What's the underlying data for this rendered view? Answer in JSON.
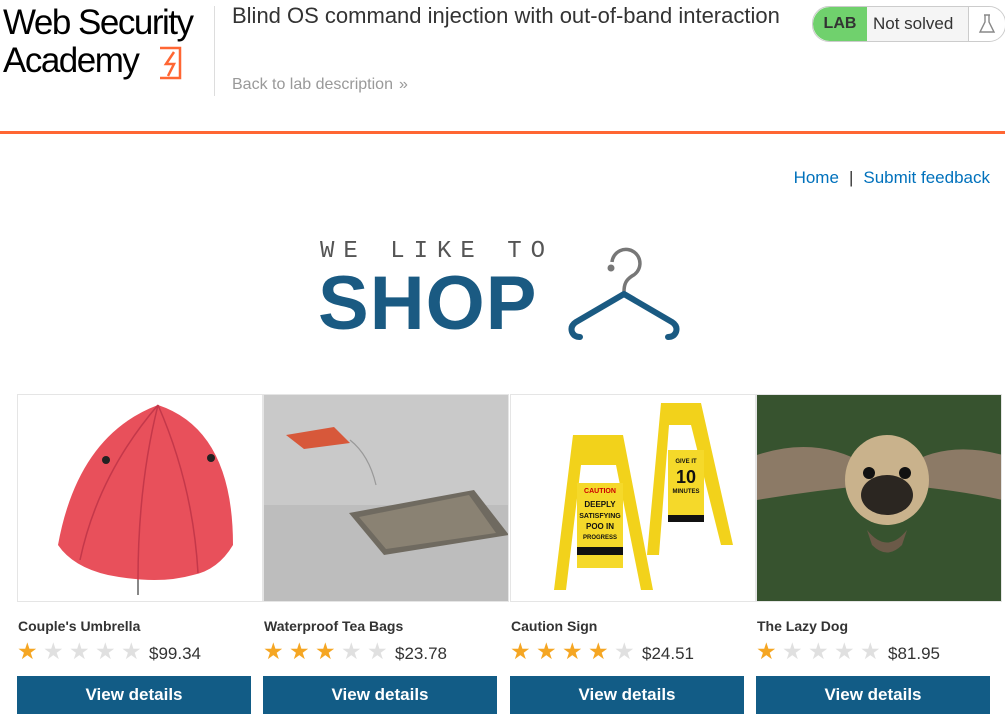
{
  "logo": {
    "line1": "Web Security",
    "line2": "Academy"
  },
  "lab": {
    "title": "Blind OS command injection with out-of-band interaction",
    "back_label": "Back to lab description",
    "status_badge": "LAB",
    "status_text": "Not solved"
  },
  "nav": {
    "home": "Home",
    "separator": "|",
    "feedback": "Submit feedback"
  },
  "banner": {
    "tagline": "WE LIKE TO",
    "headline": "SHOP"
  },
  "colors": {
    "accent": "#ff6633",
    "brand": "#125c86",
    "banner": "#1a5a82",
    "badge": "#70d16d",
    "star": "#f5a623",
    "link": "#0071bc"
  },
  "products": [
    {
      "name": "Couple's Umbrella",
      "rating": 1,
      "price": "$99.34",
      "button": "View details",
      "image": "umbrella"
    },
    {
      "name": "Waterproof Tea Bags",
      "rating": 3,
      "price": "$23.78",
      "button": "View details",
      "image": "tea-bag"
    },
    {
      "name": "Caution Sign",
      "rating": 4,
      "price": "$24.51",
      "button": "View details",
      "image": "caution-sign"
    },
    {
      "name": "The Lazy Dog",
      "rating": 1,
      "price": "$81.95",
      "button": "View details",
      "image": "flying-pug"
    }
  ],
  "images": {
    "caution_sign": {
      "left_text": [
        "CAUTION",
        "DEEPLY",
        "SATISFYING",
        "POO IN",
        "PROGRESS"
      ],
      "right_text": [
        "GIVE IT",
        "10",
        "MINUTES"
      ]
    }
  }
}
